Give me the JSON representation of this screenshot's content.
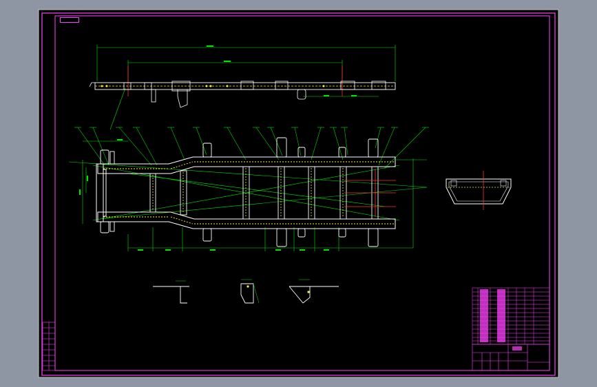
{
  "drawing": {
    "background": "#000000",
    "frame_color": "#ff40ff",
    "dimension_color": "#00e600",
    "centerline_color": "#ff3030",
    "part_color": "#ffffff",
    "weld_color": "#ffee33",
    "stamp_label": "",
    "title_block": {
      "title": "",
      "drawing_number": ""
    },
    "notes": {
      "title": "",
      "lines": [
        "",
        "",
        "",
        "",
        ""
      ]
    }
  }
}
